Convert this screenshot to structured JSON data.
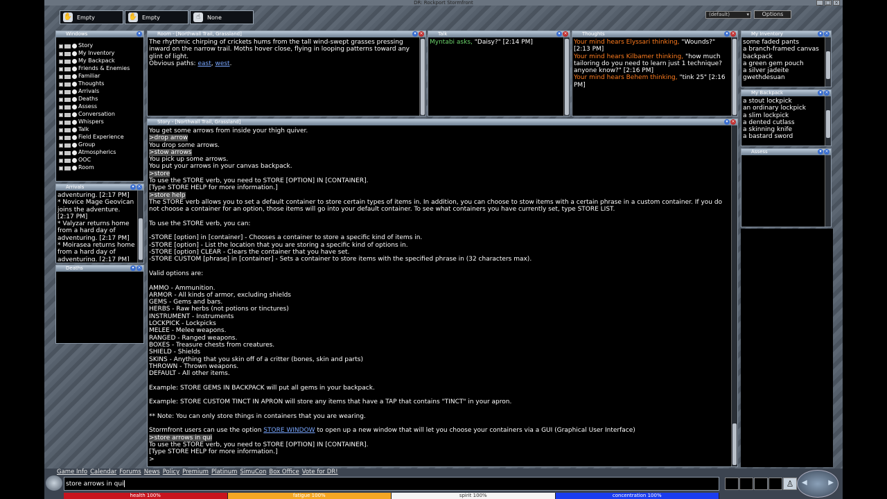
{
  "window": {
    "title": "DR: Rockport Stormfront"
  },
  "hands": [
    {
      "icon": "left-hand-icon",
      "label": "Empty"
    },
    {
      "icon": "right-hand-icon",
      "label": "Empty"
    },
    {
      "icon": "spell-hand-icon",
      "label": "None"
    }
  ],
  "profile": {
    "selected": "(default)"
  },
  "options_label": "Options",
  "windows_panel": {
    "title": "Windows",
    "items": [
      "Story",
      "My Inventory",
      "My Backpack",
      "Friends & Enemies",
      "Familiar",
      "Thoughts",
      "Arrivals",
      "Deaths",
      "Assess",
      "Conversation",
      "Whispers",
      "Talk",
      "Field Experience",
      "Group",
      "Atmospherics",
      "OOC",
      "Room"
    ]
  },
  "arrivals_panel": {
    "title": "Arrivals",
    "lines": [
      "adventuring. [2:17 PM]",
      "* Novice Mage Geovican joins the adventure. [2:17 PM]",
      "* Valyzar returns home from a hard day of adventuring. [2:17 PM]",
      "* Moirasea returns home from a hard day of adventuring. [2:17 PM]"
    ]
  },
  "deaths_panel": {
    "title": "Deaths"
  },
  "room_panel": {
    "title": "Room - [Northwall Trail, Grassland]",
    "description": "The rhythmic chirping of crickets hums from the tall wind-swept grasses pressing inward on the narrow trail.  Moths hover close, flying in looping patterns toward any glint of light.",
    "paths_label": "Obvious paths:",
    "paths": [
      "east",
      "west"
    ],
    "paths_sep": ", ",
    "paths_end": "."
  },
  "talk_panel": {
    "title": "Talk",
    "speaker": "Myntabi asks,",
    "message": "\"Daisy?\" [2:14 PM]"
  },
  "thoughts_panel": {
    "title": "Thoughts",
    "entries": [
      {
        "prefix": "Your mind hears Elyssari thinking,",
        "text": "\"Wounds?\" [2:13 PM]"
      },
      {
        "prefix": "Your mind hears Kilbamer thinking,",
        "text": "\"how much tailoring do you need to learn just 1 technique? anyone know?\" [2:16 PM]"
      },
      {
        "prefix": "Your mind hears Behem thinking,",
        "text": "\"tink 25\" [2:16 PM]"
      }
    ]
  },
  "inventory_panel": {
    "title": "My Inventory",
    "lines": [
      "some faded pants",
      "a branch-framed canvas backpack",
      "a green gem pouch",
      "a silver jadeite gwethdesuan"
    ]
  },
  "backpack_panel": {
    "title": "My Backpack",
    "lines": [
      "a stout lockpick",
      "an ordinary lockpick",
      "a slim lockpick",
      "a dented cutlass",
      "a skinning knife",
      "a bastard sword"
    ]
  },
  "assess_panel": {
    "title": "Assess"
  },
  "story_panel": {
    "title": "Story - [Northwall Trail, Grassland]",
    "lines": [
      {
        "t": "text",
        "v": "You get some arrows from inside your thigh quiver."
      },
      {
        "t": "cmd",
        "v": ">drop arrow"
      },
      {
        "t": "text",
        "v": "You drop some arrows."
      },
      {
        "t": "cmd",
        "v": ">stow arrows"
      },
      {
        "t": "text",
        "v": "You pick up some arrows."
      },
      {
        "t": "text",
        "v": "You put your arrows in your canvas backpack."
      },
      {
        "t": "cmd",
        "v": ">store"
      },
      {
        "t": "text",
        "v": "To use the STORE verb, you need to STORE [OPTION] IN [CONTAINER]."
      },
      {
        "t": "text",
        "v": "[Type STORE HELP for more information.]"
      },
      {
        "t": "cmd",
        "v": ">store help"
      },
      {
        "t": "text",
        "v": "The STORE verb allows you to set a default container to store certain types of items in.  In addition, you can choose to stow items with a certain phrase in a custom container.  If you do not choose a container for an option, those items will go into your default container.  To see what containers you have currently set, type STORE LIST."
      },
      {
        "t": "blank",
        "v": ""
      },
      {
        "t": "text",
        "v": "To use the STORE verb, you can:"
      },
      {
        "t": "blank",
        "v": ""
      },
      {
        "t": "text",
        "v": "-STORE [option] in [container] - Chooses a container to store a specific kind of items in."
      },
      {
        "t": "text",
        "v": "-STORE [option] - List the location that you are storing a specific kind of options in."
      },
      {
        "t": "text",
        "v": "-STORE [option] CLEAR - Clears the container that you have set."
      },
      {
        "t": "text",
        "v": "-STORE CUSTOM [phrase] in [container] - Sets a container to store items with the specified phrase in  (32 characters max)."
      },
      {
        "t": "blank",
        "v": ""
      },
      {
        "t": "text",
        "v": "Valid options are:"
      },
      {
        "t": "blank",
        "v": ""
      },
      {
        "t": "text",
        "v": "AMMO - Ammunition."
      },
      {
        "t": "text",
        "v": "ARMOR - All kinds of armor, excluding shields"
      },
      {
        "t": "text",
        "v": "GEMS - Gems and bars."
      },
      {
        "t": "text",
        "v": "HERBS - Raw herbs (not potions or tinctures)"
      },
      {
        "t": "text",
        "v": "INSTRUMENT - Instruments"
      },
      {
        "t": "text",
        "v": "LOCKPICK - Lockpicks"
      },
      {
        "t": "text",
        "v": "MELEE - Melee weapons."
      },
      {
        "t": "text",
        "v": "RANGED - Ranged weapons."
      },
      {
        "t": "text",
        "v": "BOXES - Treasure chests from creatures."
      },
      {
        "t": "text",
        "v": "SHIELD - Shields"
      },
      {
        "t": "text",
        "v": "SKINS - Anything that you skin off of a critter (bones, skin and parts)"
      },
      {
        "t": "text",
        "v": "THROWN - Thrown weapons."
      },
      {
        "t": "text",
        "v": "DEFAULT - All other items."
      },
      {
        "t": "blank",
        "v": ""
      },
      {
        "t": "text",
        "v": "Example:  STORE GEMS IN BACKPACK will put all gems in your backpack."
      },
      {
        "t": "blank",
        "v": ""
      },
      {
        "t": "text",
        "v": "Example:  STORE CUSTOM TINCT IN APRON will store any items that have a TAP that contains \"TINCT\" in your apron."
      },
      {
        "t": "blank",
        "v": ""
      },
      {
        "t": "text",
        "v": "** Note:  You can only store things in containers that you are wearing."
      },
      {
        "t": "blank",
        "v": ""
      },
      {
        "t": "link",
        "pre": "Stormfront users can use the option ",
        "link": "STORE WINDOW",
        "post": " to open up a new window that will let you choose your containers via a GUI (Graphical User Interface)"
      },
      {
        "t": "cmd",
        "v": ">store arrows in qui"
      },
      {
        "t": "text",
        "v": "To use the STORE verb, you need to STORE [OPTION] IN [CONTAINER]."
      },
      {
        "t": "text",
        "v": "[Type STORE HELP for more information.]"
      },
      {
        "t": "text",
        "v": ">"
      }
    ]
  },
  "links_bar": [
    "Game Info",
    "Calendar",
    "Forums",
    "News",
    "Policy",
    "Premium",
    "Platinum",
    "SimuCon",
    "Box Office",
    "Vote for DR!"
  ],
  "command_input": {
    "value": "store arrows in qui"
  },
  "vitals": [
    {
      "label": "health 100%",
      "value": 1.0,
      "color": "#c8141e"
    },
    {
      "label": "fatigue 100%",
      "value": 1.0,
      "color": "#f5a623"
    },
    {
      "label": "spirit 100%",
      "value": 1.0,
      "color": "#f4f4f4"
    },
    {
      "label": "concentration 100%",
      "value": 1.0,
      "color": "#1a3cf0"
    }
  ],
  "colors": {
    "thought_prefix": "#ff7c1e",
    "talk_speaker": "#6bd36b",
    "link": "#79a7ff"
  }
}
